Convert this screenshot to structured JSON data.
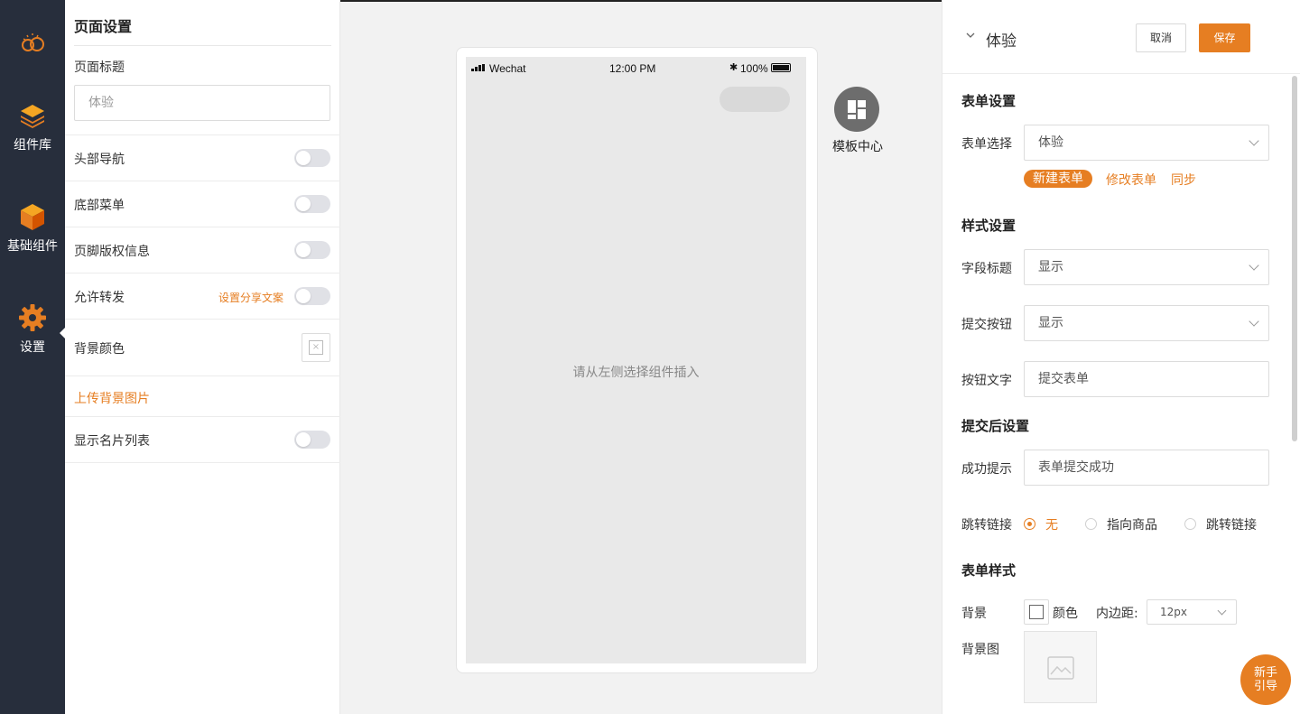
{
  "nav": {
    "items": [
      {
        "label": "组件库",
        "icon": "layers-icon"
      },
      {
        "label": "基础组件",
        "icon": "cube-icon"
      },
      {
        "label": "设置",
        "icon": "gear-icon"
      }
    ],
    "logo_icon": "cloud-logo-icon",
    "active": "设置",
    "accent": "#e67e22",
    "bg": "#272e3c"
  },
  "page_settings": {
    "title": "页面设置",
    "page_title_label": "页面标题",
    "page_title_value": "体验",
    "rows": [
      {
        "label": "头部导航",
        "on": false
      },
      {
        "label": "底部菜单",
        "on": false
      },
      {
        "label": "页脚版权信息",
        "on": false
      },
      {
        "label": "允许转发",
        "on": false
      },
      {
        "label": "显示名片列表",
        "on": false
      }
    ],
    "share_link": "设置分享文案",
    "bg_color_label": "背景颜色",
    "upload_bg": "上传背景图片"
  },
  "phone": {
    "carrier": "Wechat",
    "time": "12:00 PM",
    "battery": "100%",
    "placeholder": "请从左侧选择组件插入"
  },
  "template_center": {
    "label": "模板中心",
    "icon": "grid-icon"
  },
  "form_panel": {
    "name": "体验",
    "cancel": "取消",
    "save": "保存",
    "form_settings": {
      "title": "表单设置",
      "select_label": "表单选择",
      "select_value": "体验",
      "new_form": "新建表单",
      "edit_form": "修改表单",
      "sync": "同步"
    },
    "style_settings": {
      "title": "样式设置",
      "field_title_label": "字段标题",
      "field_title_value": "显示",
      "submit_button_label": "提交按钮",
      "submit_button_value": "显示",
      "button_text_label": "按钮文字",
      "button_text_value": "提交表单"
    },
    "after_submit": {
      "title": "提交后设置",
      "success_label": "成功提示",
      "success_value": "表单提交成功",
      "jump_label": "跳转链接",
      "options": [
        "无",
        "指向商品",
        "跳转链接"
      ],
      "selected": "无"
    },
    "form_style": {
      "title": "表单样式",
      "bg_label": "背景",
      "color_label": "颜色",
      "padding_label": "内边距:",
      "padding_value": "12px",
      "bg_image_label": "背景图"
    }
  },
  "guide_button": {
    "line1": "新手",
    "line2": "引导"
  }
}
